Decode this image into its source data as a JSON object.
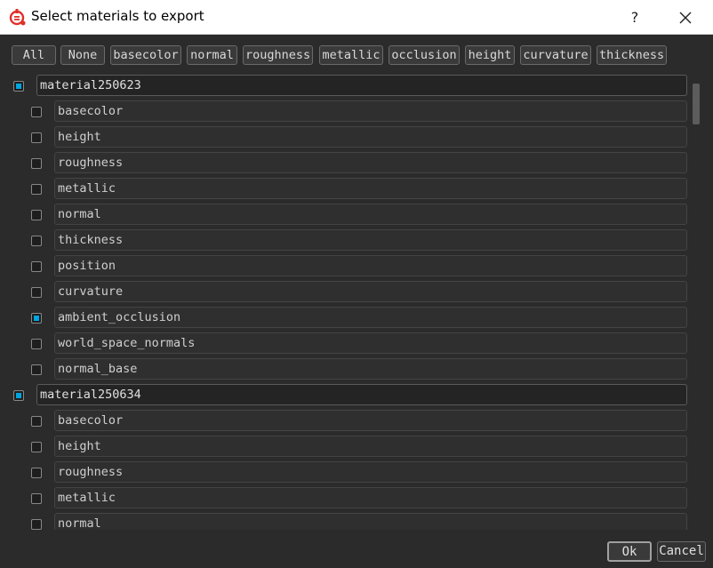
{
  "window": {
    "title": "Select materials to export",
    "help_label": "?",
    "app_icon": "substance-painter-icon",
    "close_icon": "close-icon"
  },
  "toolbar": {
    "buttons": [
      "All",
      "None",
      "basecolor",
      "normal",
      "roughness",
      "metallic",
      "occlusion",
      "height",
      "curvature",
      "thickness"
    ]
  },
  "materials": [
    {
      "name": "material250623",
      "checked": true,
      "channels": [
        {
          "label": "basecolor",
          "checked": false
        },
        {
          "label": "height",
          "checked": false
        },
        {
          "label": "roughness",
          "checked": false
        },
        {
          "label": "metallic",
          "checked": false
        },
        {
          "label": "normal",
          "checked": false
        },
        {
          "label": "thickness",
          "checked": false
        },
        {
          "label": "position",
          "checked": false
        },
        {
          "label": "curvature",
          "checked": false
        },
        {
          "label": "ambient_occlusion",
          "checked": true
        },
        {
          "label": "world_space_normals",
          "checked": false
        },
        {
          "label": "normal_base",
          "checked": false
        }
      ]
    },
    {
      "name": "material250634",
      "checked": true,
      "channels": [
        {
          "label": "basecolor",
          "checked": false
        },
        {
          "label": "height",
          "checked": false
        },
        {
          "label": "roughness",
          "checked": false
        },
        {
          "label": "metallic",
          "checked": false
        },
        {
          "label": "normal",
          "checked": false
        }
      ]
    }
  ],
  "footer": {
    "ok_label": "Ok",
    "cancel_label": "Cancel"
  },
  "colors": {
    "accent": "#00a6e0",
    "background": "#2b2b2b"
  }
}
